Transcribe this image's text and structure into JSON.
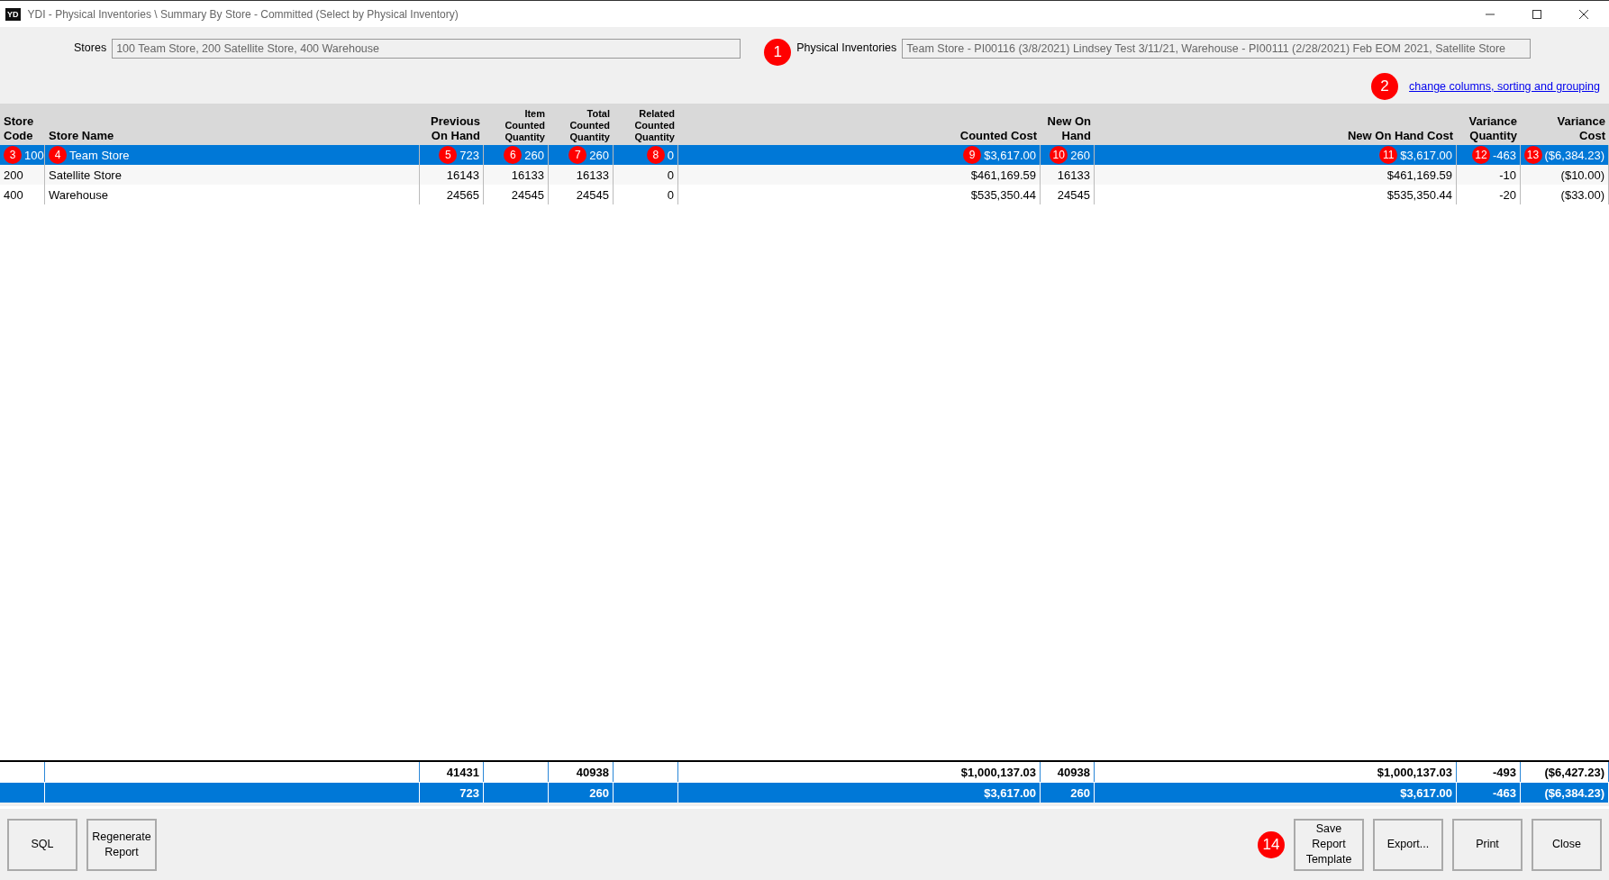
{
  "window": {
    "app_icon": "YD",
    "title": "YDI - Physical Inventories \\ Summary By Store - Committed (Select by Physical Inventory)"
  },
  "filters": [
    {
      "label": "Stores",
      "value": "100 Team Store, 200 Satellite Store, 400 Warehouse"
    },
    {
      "label": "Physical Inventories",
      "value": "Team Store - PI00116 (3/8/2021) Lindsey Test 3/11/21, Warehouse - PI00111 (2/28/2021) Feb EOM 2021, Satellite Store",
      "callout": "1"
    }
  ],
  "link": {
    "text": "change columns, sorting and grouping",
    "callout": "2"
  },
  "table": {
    "columns": [
      {
        "lines": [
          "Store",
          "Code"
        ],
        "kind": "text",
        "small": false
      },
      {
        "lines": [
          "Store Name"
        ],
        "kind": "text",
        "small": false
      },
      {
        "lines": [
          "Previous",
          "On Hand"
        ],
        "kind": "number",
        "small": false
      },
      {
        "lines": [
          "Item",
          "Counted",
          "Quantity"
        ],
        "kind": "number",
        "small": true
      },
      {
        "lines": [
          "Total",
          "Counted",
          "Quantity"
        ],
        "kind": "number",
        "small": true
      },
      {
        "lines": [
          "Related",
          "Counted",
          "Quantity"
        ],
        "kind": "number",
        "small": true
      },
      {
        "lines": [
          "Counted Cost"
        ],
        "kind": "number",
        "small": false
      },
      {
        "lines": [
          "New On",
          "Hand"
        ],
        "kind": "number",
        "small": false
      },
      {
        "lines": [
          "New On Hand Cost"
        ],
        "kind": "number",
        "small": false
      },
      {
        "lines": [
          "Variance",
          "Quantity"
        ],
        "kind": "number",
        "small": false
      },
      {
        "lines": [
          "Variance",
          "Cost"
        ],
        "kind": "number",
        "small": false
      }
    ],
    "rows": [
      {
        "selected": true,
        "cells": [
          {
            "text": "100",
            "callout": "3"
          },
          {
            "text": "Team Store",
            "callout": "4"
          },
          {
            "text": "723",
            "callout": "5"
          },
          {
            "text": "260",
            "callout": "6"
          },
          {
            "text": "260",
            "callout": "7"
          },
          {
            "text": "0",
            "callout": "8"
          },
          {
            "text": "$3,617.00",
            "callout": "9"
          },
          {
            "text": "260",
            "callout": "10"
          },
          {
            "text": "$3,617.00",
            "callout": "11"
          },
          {
            "text": "-463",
            "callout": "12"
          },
          {
            "text": "($6,384.23)",
            "callout": "13"
          }
        ]
      },
      {
        "selected": false,
        "cells": [
          {
            "text": "200"
          },
          {
            "text": "Satellite Store"
          },
          {
            "text": "16143"
          },
          {
            "text": "16133"
          },
          {
            "text": "16133"
          },
          {
            "text": "0"
          },
          {
            "text": "$461,169.59"
          },
          {
            "text": "16133"
          },
          {
            "text": "$461,169.59"
          },
          {
            "text": "-10"
          },
          {
            "text": "($10.00)"
          }
        ]
      },
      {
        "selected": false,
        "cells": [
          {
            "text": "400"
          },
          {
            "text": "Warehouse"
          },
          {
            "text": "24565"
          },
          {
            "text": "24545"
          },
          {
            "text": "24545"
          },
          {
            "text": "0"
          },
          {
            "text": "$535,350.44"
          },
          {
            "text": "24545"
          },
          {
            "text": "$535,350.44"
          },
          {
            "text": "-20"
          },
          {
            "text": "($33.00)"
          }
        ]
      }
    ],
    "totals": [
      {
        "kind": "grand",
        "cells": [
          null,
          null,
          "41431",
          null,
          "40938",
          null,
          "$1,000,137.03",
          "40938",
          "$1,000,137.03",
          "-493",
          "($6,427.23)"
        ]
      },
      {
        "kind": "selection",
        "cells": [
          null,
          null,
          "723",
          null,
          "260",
          null,
          "$3,617.00",
          "260",
          "$3,617.00",
          "-463",
          "($6,384.23)"
        ]
      }
    ]
  },
  "buttons_left": [
    {
      "lines": [
        "SQL"
      ]
    },
    {
      "lines": [
        "Regenerate",
        "Report"
      ]
    }
  ],
  "buttons_right_callout": "14",
  "buttons_right": [
    {
      "lines": [
        "Save",
        "Report",
        "Template"
      ]
    },
    {
      "lines": [
        "Export..."
      ]
    },
    {
      "lines": [
        "Print"
      ]
    },
    {
      "lines": [
        "Close"
      ]
    }
  ]
}
